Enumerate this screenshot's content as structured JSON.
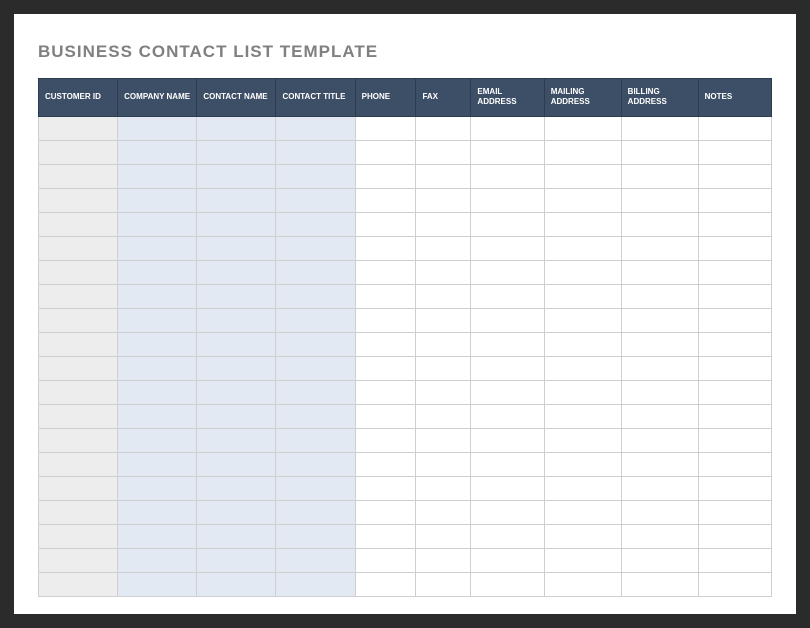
{
  "title": "BUSINESS CONTACT LIST TEMPLATE",
  "columns": [
    "CUSTOMER ID",
    "COMPANY NAME",
    "CONTACT NAME",
    "CONTACT TITLE",
    "PHONE",
    "FAX",
    "EMAIL ADDRESS",
    "MAILING ADDRESS",
    "BILLING ADDRESS",
    "NOTES"
  ],
  "row_count": 20,
  "colors": {
    "header_bg": "#3d4f66",
    "id_col_bg": "#ededed",
    "light_col_bg": "#e2e9f2",
    "white_col_bg": "#ffffff",
    "title_text": "#808080"
  }
}
